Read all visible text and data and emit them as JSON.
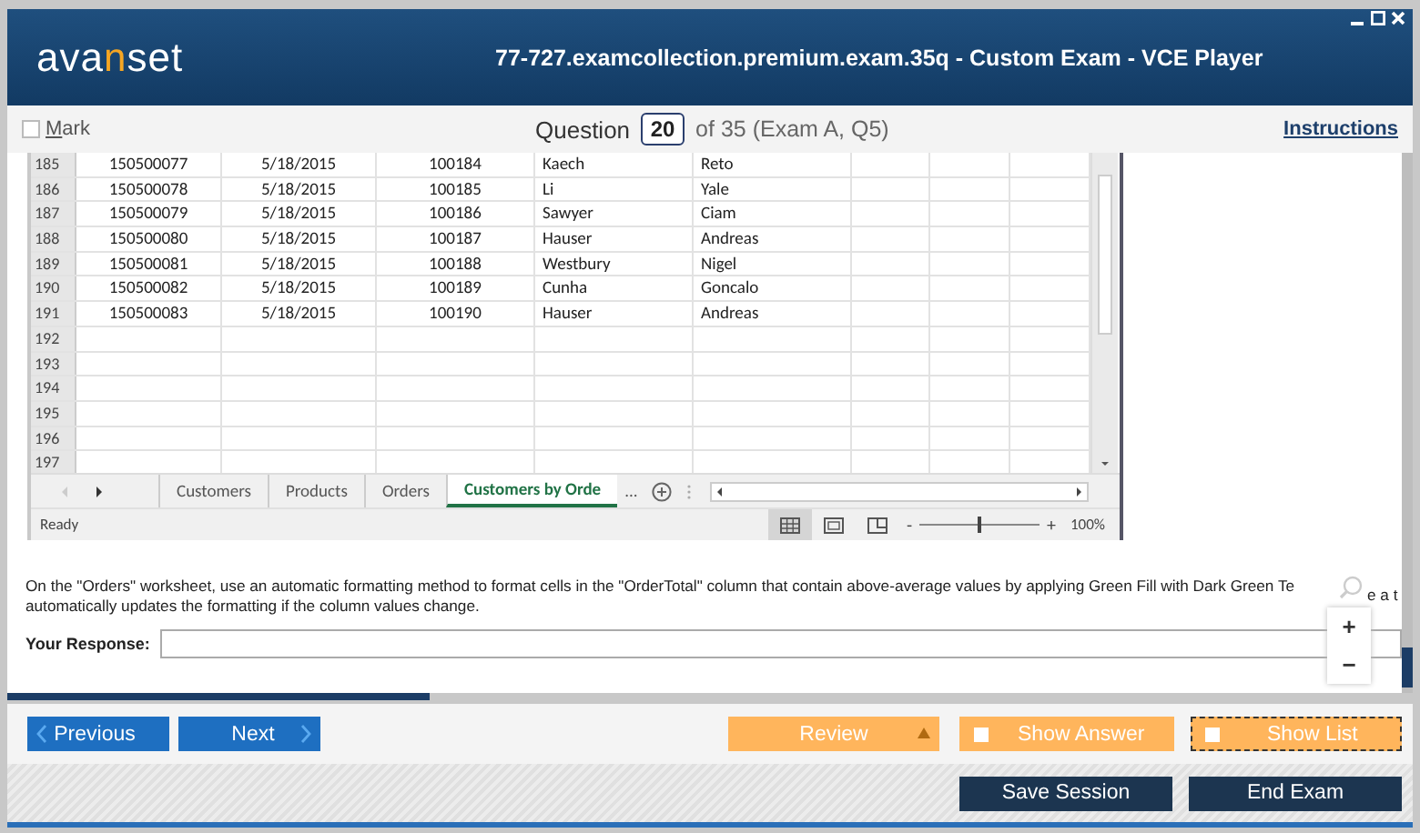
{
  "window": {
    "title": "77-727.examcollection.premium.exam.35q - Custom Exam - VCE Player",
    "logo": [
      {
        "text": "ava",
        "accent": false
      },
      {
        "text": "n",
        "accent": true
      },
      {
        "text": "set",
        "accent": false
      }
    ]
  },
  "toolbar": {
    "mark": {
      "label": "Mark",
      "checked": false
    },
    "question_label": "Question",
    "question_number": "20",
    "question_of": "of 35 (Exam A, Q5)",
    "instructions": "Instructions"
  },
  "spreadsheet": {
    "rows": [
      {
        "header": "185",
        "cells": [
          "150500077",
          "5/18/2015",
          "100184",
          "Kaech",
          "Reto"
        ]
      },
      {
        "header": "186",
        "cells": [
          "150500078",
          "5/18/2015",
          "100185",
          "Li",
          "Yale"
        ]
      },
      {
        "header": "187",
        "cells": [
          "150500079",
          "5/18/2015",
          "100186",
          "Sawyer",
          "Ciam"
        ]
      },
      {
        "header": "188",
        "cells": [
          "150500080",
          "5/18/2015",
          "100187",
          "Hauser",
          "Andreas"
        ]
      },
      {
        "header": "189",
        "cells": [
          "150500081",
          "5/18/2015",
          "100188",
          "Westbury",
          "Nigel"
        ]
      },
      {
        "header": "190",
        "cells": [
          "150500082",
          "5/18/2015",
          "100189",
          "Cunha",
          "Goncalo"
        ]
      },
      {
        "header": "191",
        "cells": [
          "150500083",
          "5/18/2015",
          "100190",
          "Hauser",
          "Andreas"
        ]
      },
      {
        "header": "192"
      },
      {
        "header": "193"
      },
      {
        "header": "194"
      },
      {
        "header": "195"
      },
      {
        "header": "196"
      },
      {
        "header": "197"
      }
    ],
    "sheet_tabs": [
      {
        "label": "Customers",
        "selected": false
      },
      {
        "label": "Products",
        "selected": false
      },
      {
        "label": "Orders",
        "selected": false
      },
      {
        "label": "Customers by Orde",
        "selected": true
      }
    ],
    "more_tabs": "...",
    "status": "Ready",
    "views": [
      {
        "kind": "normal",
        "selected": true
      },
      {
        "kind": "page-layout",
        "selected": false
      },
      {
        "kind": "page-break",
        "selected": false
      }
    ],
    "zoom_minus": "-",
    "zoom_plus": "+",
    "zoom": {
      "level": 0.5,
      "reading": "100%"
    }
  },
  "question": {
    "lines": [
      "On the \"Orders\" worksheet, use an automatic formatting method to format cells in the \"OrderTotal\" column that contain above-average values by applying Green Fill with Dark Green Te",
      "automatically updates the formatting if the column values change."
    ],
    "fragment": "e a t"
  },
  "response": {
    "label": "Your Response:"
  },
  "zoom_controls": [
    "+",
    "−"
  ],
  "progress": {
    "level": 0.3
  },
  "nav": {
    "previous": "Previous",
    "next": "Next",
    "review": "Review",
    "show_answer": {
      "label": "Show Answer",
      "checked": false
    },
    "show_list": {
      "label": "Show List",
      "checked": false
    }
  },
  "footer": {
    "buttons": [
      "Save Session",
      "End Exam"
    ]
  }
}
